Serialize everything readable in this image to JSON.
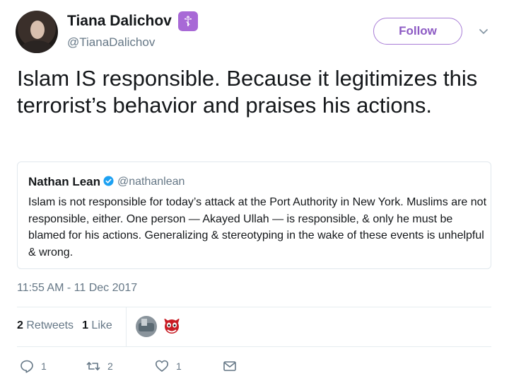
{
  "author": {
    "display_name": "Tiana Dalichov",
    "badge_icon": "orthodox-cross-icon",
    "badge_symbol": "☦",
    "badge_color": "#a869d6",
    "handle": "@TianaDalichov"
  },
  "follow_button": {
    "label": "Follow",
    "color": "#8d5bc4"
  },
  "tweet": {
    "text": "Islam IS responsible. Because it legitimizes this terrorist’s behavior and praises his actions."
  },
  "quoted_tweet": {
    "name": "Nathan Lean",
    "verified": true,
    "handle": "@nathanlean",
    "text": "Islam is not responsible for today’s attack at the Port Authority in New York. Muslims are not responsible, either. One person — Akayed Ullah — is responsible, & only he must be blamed for his actions. Generalizing & stereotyping in the wake of these events is unhelpful & wrong."
  },
  "timestamp": "11:55 AM - 11 Dec 2017",
  "stats": {
    "retweets_count": "2",
    "retweets_label": "Retweets",
    "likes_count": "1",
    "likes_label": "Like"
  },
  "actions": {
    "reply_count": "1",
    "retweet_count": "2",
    "like_count": "1"
  },
  "colors": {
    "text": "#14171a",
    "secondary": "#657786",
    "border": "#e1e8ed",
    "verified_blue": "#1da1f2"
  }
}
